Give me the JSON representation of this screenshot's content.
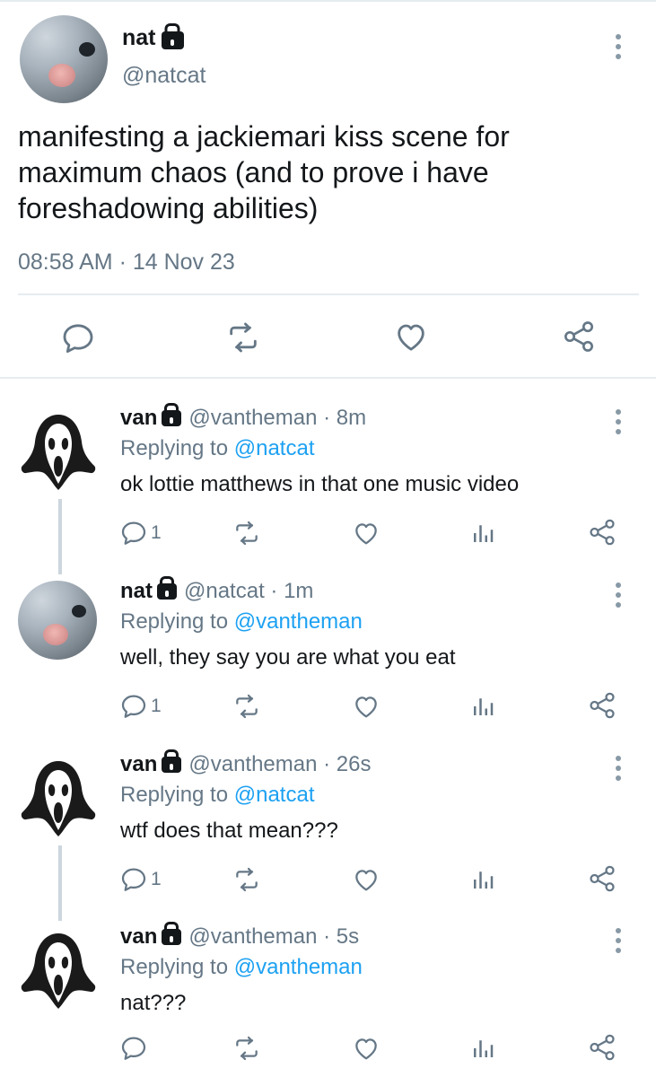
{
  "main_tweet": {
    "author_name": "nat",
    "author_handle": "@natcat",
    "text": "manifesting a jackiemari kiss scene for maximum chaos (and to prove i have foreshadowing abilities)",
    "timestamp": "08:58 AM · 14 Nov 23",
    "protected": true
  },
  "replies": [
    {
      "author_name": "van",
      "handle_time": "@vantheman · 8m",
      "replying_prefix": "Replying to ",
      "replying_to": "@natcat",
      "text": "ok lottie matthews in that one music video",
      "reply_count": "1",
      "avatar": "ghostface"
    },
    {
      "author_name": "nat",
      "handle_time": "@natcat · 1m",
      "replying_prefix": "Replying to ",
      "replying_to": "@vantheman",
      "text": "well, they say you are what you eat",
      "reply_count": "1",
      "avatar": "cat"
    },
    {
      "author_name": "van",
      "handle_time": "@vantheman · 26s",
      "replying_prefix": "Replying to ",
      "replying_to": "@natcat",
      "text": "wtf does that mean???",
      "reply_count": "1",
      "avatar": "ghostface"
    },
    {
      "author_name": "van",
      "handle_time": "@vantheman · 5s",
      "replying_prefix": "Replying to ",
      "replying_to": "@vantheman",
      "text": "nat???",
      "reply_count": "",
      "avatar": "ghostface"
    }
  ],
  "icons": {
    "reply": "comment-icon",
    "retweet": "retweet-icon",
    "like": "heart-icon",
    "analytics": "analytics-icon",
    "share": "share-icon",
    "more": "more-vertical-icon",
    "lock": "lock-icon"
  },
  "colors": {
    "text": "#14171a",
    "secondary": "#657786",
    "link": "#1da1f2",
    "divider": "#e6ecf0",
    "icon": "#657786"
  }
}
